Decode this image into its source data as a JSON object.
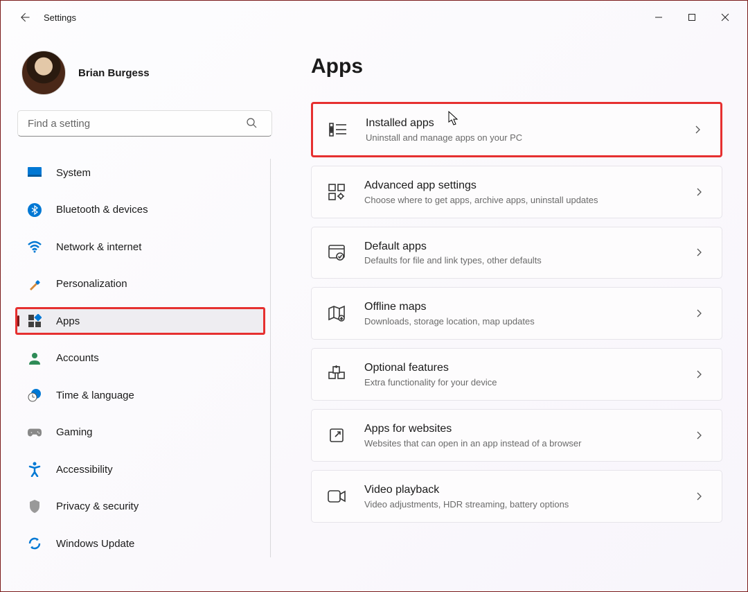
{
  "window": {
    "title": "Settings"
  },
  "user": {
    "name": "Brian Burgess"
  },
  "search": {
    "placeholder": "Find a setting"
  },
  "nav": {
    "items": [
      {
        "key": "system",
        "label": "System"
      },
      {
        "key": "bluetooth",
        "label": "Bluetooth & devices"
      },
      {
        "key": "network",
        "label": "Network & internet"
      },
      {
        "key": "personalization",
        "label": "Personalization"
      },
      {
        "key": "apps",
        "label": "Apps",
        "selected": true,
        "highlighted": true
      },
      {
        "key": "accounts",
        "label": "Accounts"
      },
      {
        "key": "time",
        "label": "Time & language"
      },
      {
        "key": "gaming",
        "label": "Gaming"
      },
      {
        "key": "accessibility",
        "label": "Accessibility"
      },
      {
        "key": "privacy",
        "label": "Privacy & security"
      },
      {
        "key": "update",
        "label": "Windows Update"
      }
    ]
  },
  "page": {
    "title": "Apps"
  },
  "cards": [
    {
      "key": "installed",
      "title": "Installed apps",
      "sub": "Uninstall and manage apps on your PC",
      "highlighted": true
    },
    {
      "key": "advanced",
      "title": "Advanced app settings",
      "sub": "Choose where to get apps, archive apps, uninstall updates"
    },
    {
      "key": "default",
      "title": "Default apps",
      "sub": "Defaults for file and link types, other defaults"
    },
    {
      "key": "offline",
      "title": "Offline maps",
      "sub": "Downloads, storage location, map updates"
    },
    {
      "key": "optional",
      "title": "Optional features",
      "sub": "Extra functionality for your device"
    },
    {
      "key": "websites",
      "title": "Apps for websites",
      "sub": "Websites that can open in an app instead of a browser"
    },
    {
      "key": "video",
      "title": "Video playback",
      "sub": "Video adjustments, HDR streaming, battery options"
    }
  ]
}
